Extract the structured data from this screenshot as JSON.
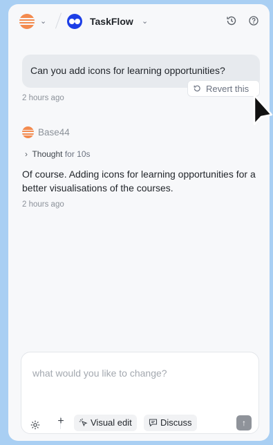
{
  "header": {
    "app_name": "TaskFlow",
    "icons": [
      "base44-logo-icon",
      "chevron-down-icon",
      "taskflow-logo-icon",
      "history-icon",
      "help-icon"
    ]
  },
  "conversation": {
    "user_message": "Can you add icons for learning opportunities?",
    "revert_label": "Revert this",
    "user_timestamp": "2 hours ago",
    "assistant_name": "Base44",
    "thought_label": "Thought",
    "thought_duration": "for 10s",
    "assistant_message": "Of course. Adding icons for learning opportunities for a better visualisations of the courses.",
    "assistant_timestamp": "2 hours ago"
  },
  "composer": {
    "placeholder": "what would you like to change?",
    "plus_label": "+",
    "visual_edit_label": "Visual edit",
    "discuss_label": "Discuss",
    "send_label": "↑"
  },
  "colors": {
    "background": "#a9cff3",
    "panel": "#f7f8fa",
    "brand_orange": "#f38a4e",
    "taskflow_blue": "#1d3fe6"
  }
}
